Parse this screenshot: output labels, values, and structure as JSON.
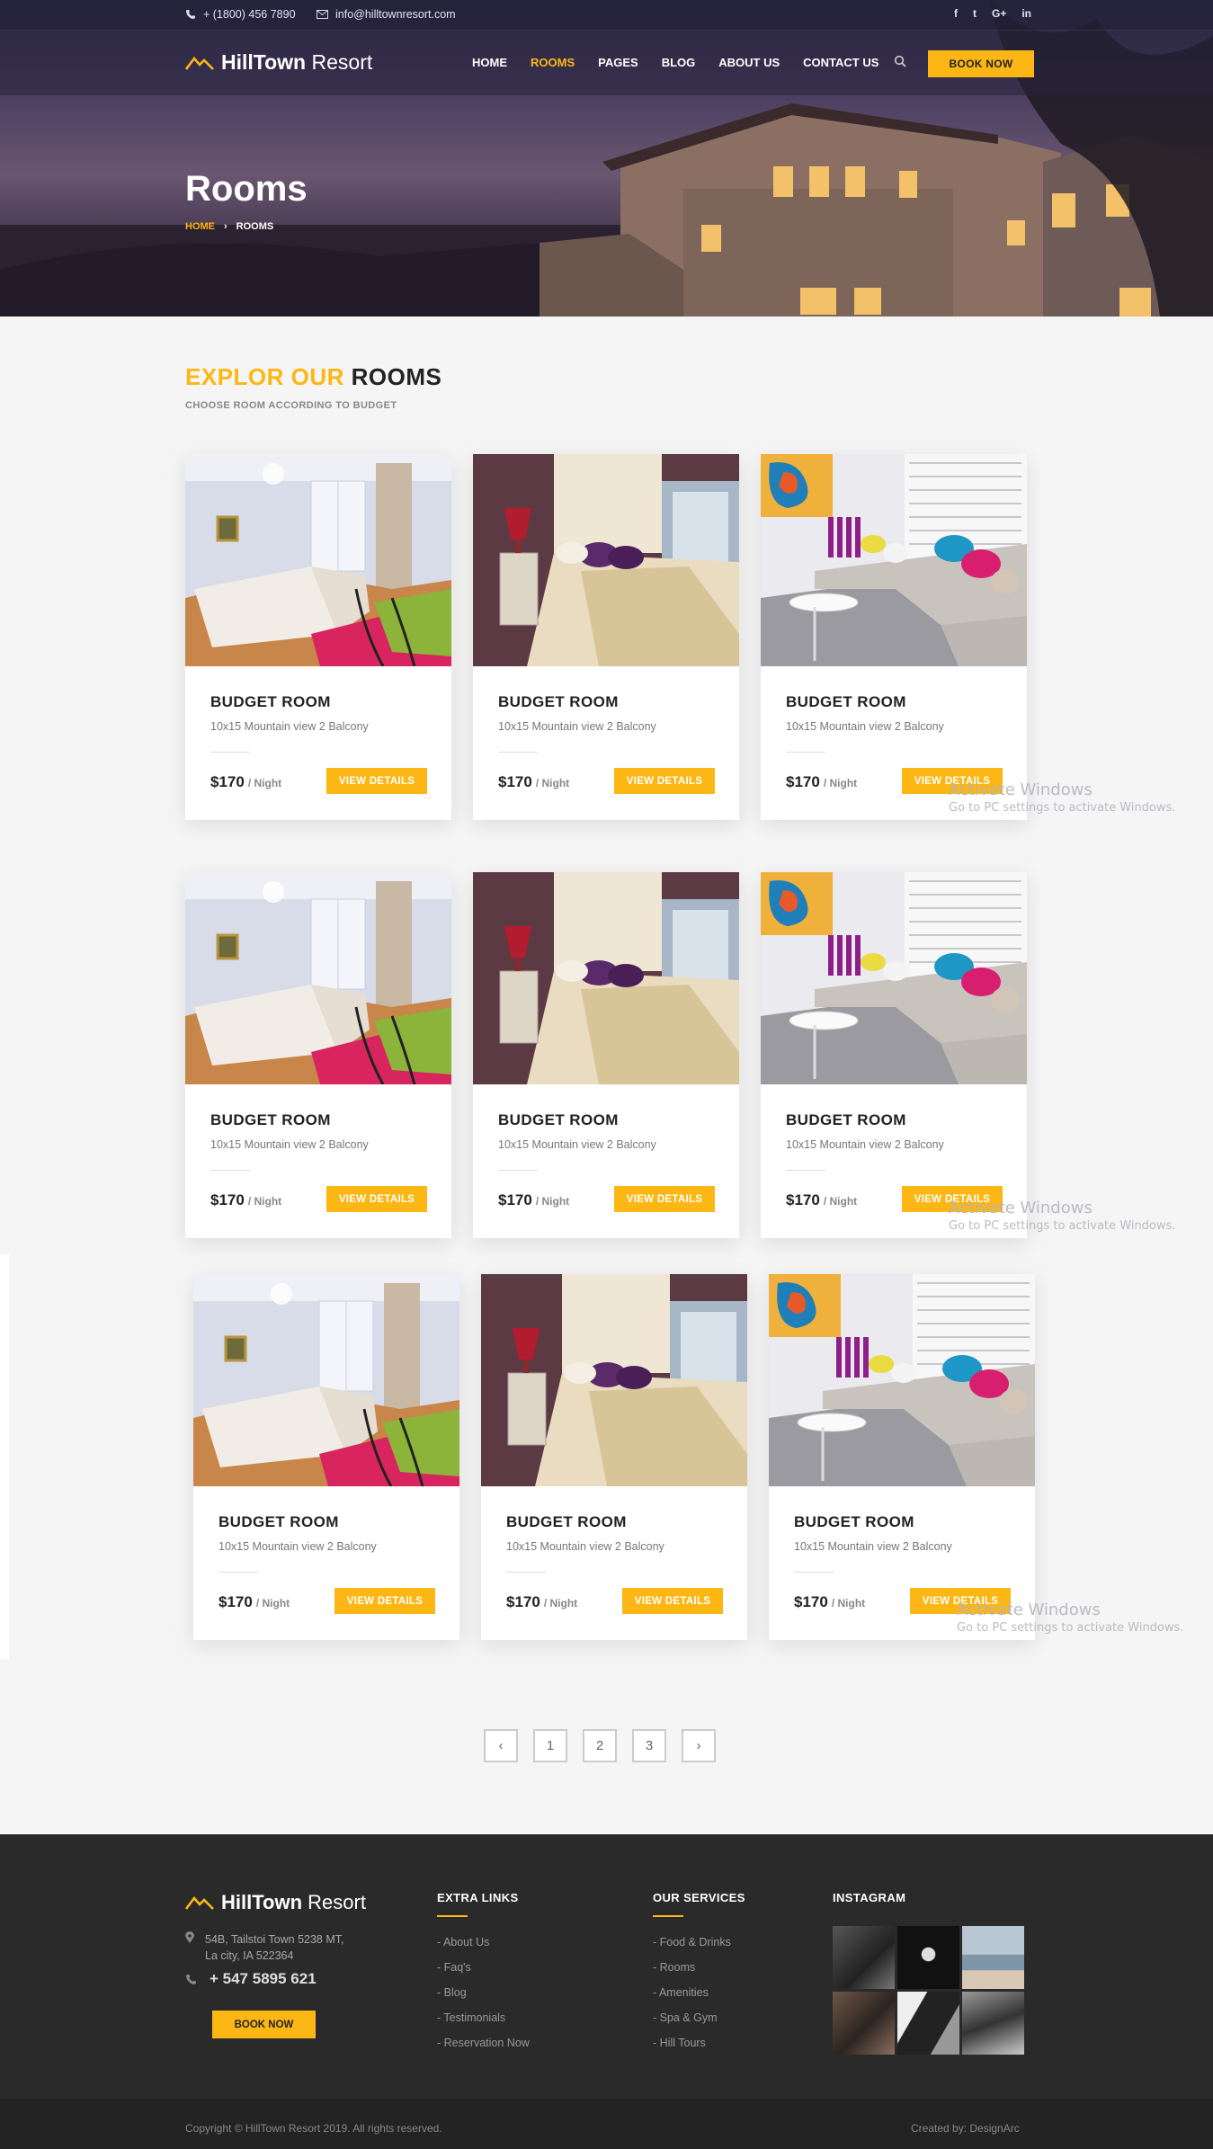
{
  "colors": {
    "accent": "#fcb715",
    "footer_bg": "#2a2a2b"
  },
  "topbar": {
    "phone_icon": "phone-icon",
    "phone": "+ (1800) 456 7890",
    "email_icon": "mail-icon",
    "email": "info@hilltownresort.com",
    "social": [
      "f",
      "t",
      "G+",
      "in"
    ]
  },
  "brand": {
    "name_bold": "HillTown",
    "name_light": "Resort"
  },
  "nav": {
    "items": [
      "HOME",
      "ROOMS",
      "PAGES",
      "BLOG",
      "ABOUT US",
      "CONTACT US"
    ],
    "active": "ROOMS",
    "book_now": "BOOK NOW"
  },
  "hero": {
    "title": "Rooms",
    "breadcrumb_home": "HOME",
    "breadcrumb_sep": "›",
    "breadcrumb_current": "ROOMS"
  },
  "section": {
    "title_highlight": "EXPLOR OUR",
    "title_rest": "ROOMS",
    "subtitle": "CHOOSE ROOM ACCORDING TO BUDGET"
  },
  "rooms": [
    {
      "name": "BUDGET ROOM",
      "desc": "10x15 Mountain view 2 Balcony",
      "price": "$170",
      "per": "/ Night",
      "button": "VIEW DETAILS"
    },
    {
      "name": "BUDGET ROOM",
      "desc": "10x15 Mountain view 2 Balcony",
      "price": "$170",
      "per": "/ Night",
      "button": "VIEW DETAILS"
    },
    {
      "name": "BUDGET ROOM",
      "desc": "10x15 Mountain view 2 Balcony",
      "price": "$170",
      "per": "/ Night",
      "button": "VIEW DETAILS"
    },
    {
      "name": "BUDGET ROOM",
      "desc": "10x15 Mountain view 2 Balcony",
      "price": "$170",
      "per": "/ Night",
      "button": "VIEW DETAILS"
    },
    {
      "name": "BUDGET ROOM",
      "desc": "10x15 Mountain view 2 Balcony",
      "price": "$170",
      "per": "/ Night",
      "button": "VIEW DETAILS"
    },
    {
      "name": "BUDGET ROOM",
      "desc": "10x15 Mountain view 2 Balcony",
      "price": "$170",
      "per": "/ Night",
      "button": "VIEW DETAILS"
    },
    {
      "name": "BUDGET ROOM",
      "desc": "10x15 Mountain view 2 Balcony",
      "price": "$170",
      "per": "/ Night",
      "button": "VIEW DETAILS"
    },
    {
      "name": "BUDGET ROOM",
      "desc": "10x15 Mountain view 2 Balcony",
      "price": "$170",
      "per": "/ Night",
      "button": "VIEW DETAILS"
    },
    {
      "name": "BUDGET ROOM",
      "desc": "10x15 Mountain view 2 Balcony",
      "price": "$170",
      "per": "/ Night",
      "button": "VIEW DETAILS"
    }
  ],
  "pagination": {
    "prev": "‹",
    "pages": [
      "1",
      "2",
      "3"
    ],
    "next": "›"
  },
  "watermark": {
    "line1": "Activate Windows",
    "line2": "Go to PC settings to activate Windows."
  },
  "footer": {
    "address_line1": "54B, Tailstoi Town 5238 MT,",
    "address_line2": "La city, IA 522364",
    "phone": "+ 547 5895 621",
    "book_now": "BOOK NOW",
    "extra_links": {
      "title": "EXTRA LINKS",
      "items": [
        "- About Us",
        "- Faq's",
        "- Blog",
        "- Testimonials",
        "- Reservation Now"
      ]
    },
    "services": {
      "title": "OUR SERVICES",
      "items": [
        "- Food & Drinks",
        "- Rooms",
        "- Amenities",
        "- Spa & Gym",
        "- Hill Tours"
      ]
    },
    "instagram": {
      "title": "INSTAGRAM"
    },
    "copyright": "Copyright © HillTown Resort 2019. All rights reserved.",
    "credit": "Created by: DesignArc"
  }
}
